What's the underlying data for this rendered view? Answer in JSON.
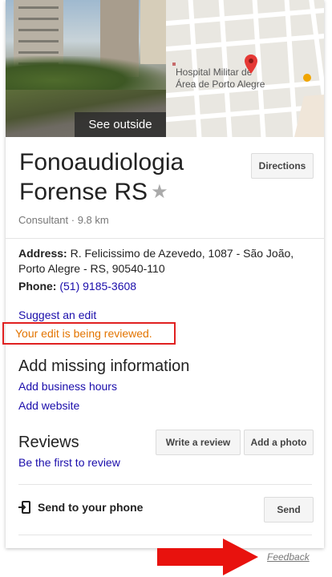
{
  "hero": {
    "see_outside": "See outside",
    "map_label_line1": "Hospital Militar de",
    "map_label_line2": "Área de Porto Alegre"
  },
  "place": {
    "title_line1": "Fonoaudiologia",
    "title_line2": "Forense RS",
    "category": "Consultant",
    "distance": "9.8 km",
    "directions_label": "Directions"
  },
  "details": {
    "address_label": "Address:",
    "address_line1": "R. Felicissimo de Azevedo, 1087 - São João,",
    "address_line2": "Porto Alegre - RS, 90540-110",
    "phone_label": "Phone:",
    "phone_value": "(51) 9185-3608"
  },
  "edit": {
    "suggest_label": "Suggest an edit",
    "status": "Your edit is being reviewed."
  },
  "missing": {
    "title": "Add missing information",
    "add_hours": "Add business hours",
    "add_website": "Add website"
  },
  "reviews": {
    "title": "Reviews",
    "first_review": "Be the first to review",
    "write_review": "Write a review",
    "add_photo": "Add a photo"
  },
  "send": {
    "label": "Send to your phone",
    "button": "Send"
  },
  "footer": {
    "feedback": "Feedback"
  },
  "colors": {
    "link": "#1a0dab",
    "status_orange": "#e37400",
    "highlight_red": "#e02020",
    "map_pin": "#e53935"
  }
}
